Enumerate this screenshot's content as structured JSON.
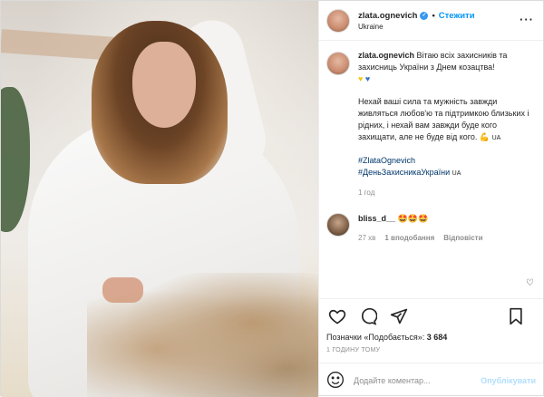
{
  "author": {
    "username": "zlata.ognevich",
    "follow_label": "Стежити",
    "location": "Ukraine"
  },
  "caption": {
    "line1": "Вітаю всіх захисників та захисниць України з Днем козацтва!",
    "p2": "Нехай ваші сила та мужність завжди живляться любов'ю та підтримкою близьких і рідних, і нехай вам завжди буде кого захищати, але не буде від кого.",
    "tag1": "#ZlataOgnevich",
    "tag2": "#ДеньЗахисникаУкраїни",
    "translate_mark": "UA",
    "time": "1 год"
  },
  "comment": {
    "username": "bliss_d__",
    "text": "🤩🤩🤩",
    "time": "27 хв",
    "likes": "1 вподобання",
    "reply": "Відповісти"
  },
  "likes_prefix": "Позначки «Подобається»:",
  "likes_count": "3 684",
  "posted_ago": "1 ГОДИНУ ТОМУ",
  "comment_input_placeholder": "Додайте коментар...",
  "publish_label": "Опублікувати",
  "icons": [
    "more-options-icon",
    "verified-icon",
    "heart-icon",
    "comment-icon",
    "share-icon",
    "bookmark-icon",
    "emoji-icon"
  ]
}
